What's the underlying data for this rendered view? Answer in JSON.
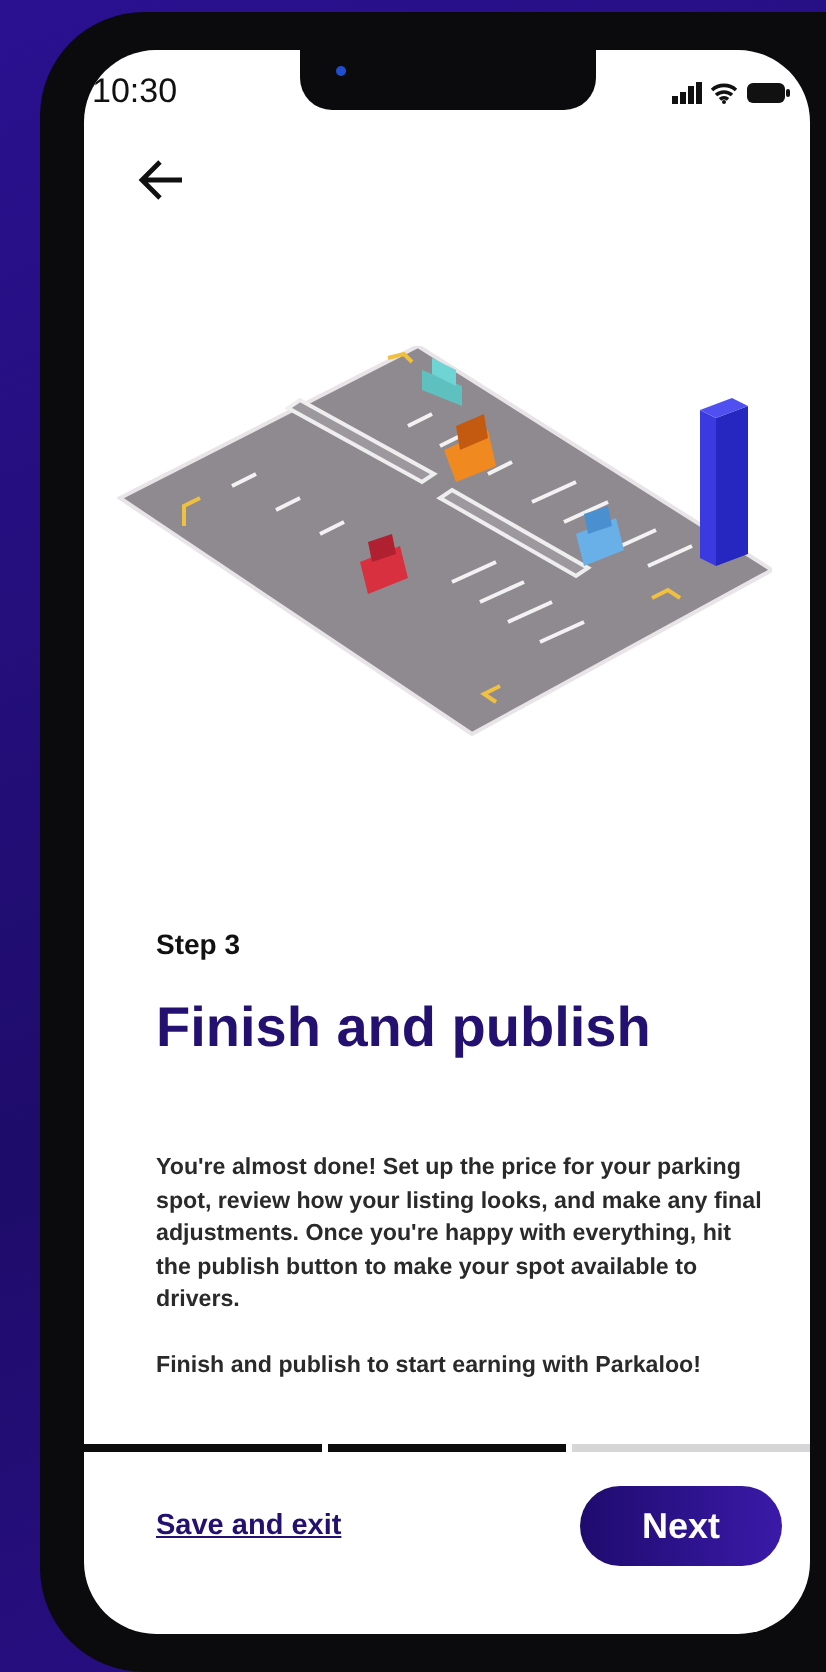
{
  "status_bar": {
    "time": "10:30"
  },
  "step_label": "Step 3",
  "title": "Finish and publish",
  "paragraphs": [
    "You're almost done! Set up the price for your parking spot, review how your listing looks, and make any final adjustments. Once you're happy with everything, hit the publish button to make your spot available to drivers.",
    "Finish and publish to start earning with Parkaloo!"
  ],
  "progress": [
    {
      "filled": true
    },
    {
      "filled": true
    },
    {
      "filled": false
    }
  ],
  "footer": {
    "link": "Save and exit",
    "button": "Next"
  }
}
